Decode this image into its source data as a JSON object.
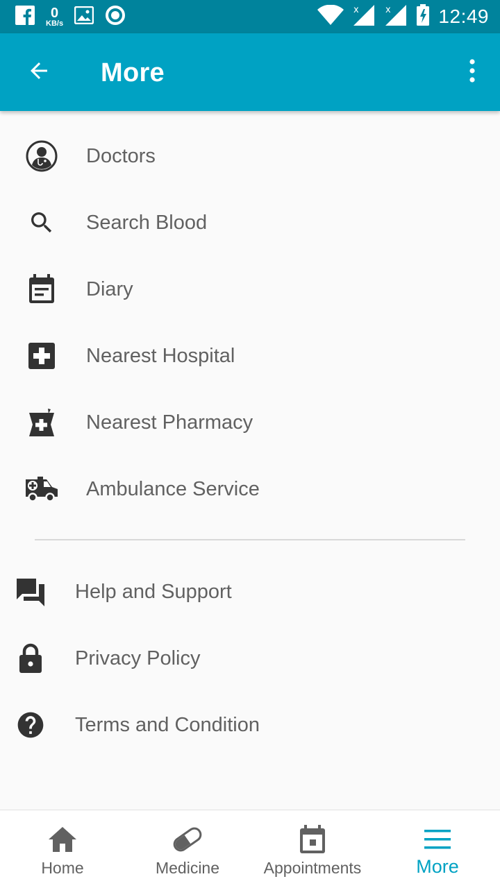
{
  "status_bar": {
    "net_speed_value": "0",
    "net_speed_unit": "KB/s",
    "time": "12:49",
    "icons": [
      "facebook-icon",
      "gallery-icon",
      "record-icon",
      "wifi-icon",
      "signal-icon",
      "signal-icon",
      "battery-charging-icon"
    ]
  },
  "app_bar": {
    "title": "More",
    "color": "#00a2c3"
  },
  "menu": {
    "items": [
      {
        "label": "Doctors",
        "icon": "doctor-icon"
      },
      {
        "label": "Search Blood",
        "icon": "search-icon"
      },
      {
        "label": "Diary",
        "icon": "diary-icon"
      },
      {
        "label": "Nearest Hospital",
        "icon": "hospital-icon"
      },
      {
        "label": "Nearest Pharmacy",
        "icon": "pharmacy-icon"
      },
      {
        "label": "Ambulance Service",
        "icon": "ambulance-icon"
      }
    ],
    "support_items": [
      {
        "label": "Help and Support",
        "icon": "chat-icon"
      },
      {
        "label": "Privacy Policy",
        "icon": "lock-icon"
      },
      {
        "label": "Terms and Condition",
        "icon": "help-icon"
      }
    ]
  },
  "bottom_nav": {
    "tabs": [
      {
        "label": "Home",
        "icon": "home-icon"
      },
      {
        "label": "Medicine",
        "icon": "pill-icon"
      },
      {
        "label": "Appointments",
        "icon": "calendar-icon"
      },
      {
        "label": "More",
        "icon": "menu-icon"
      }
    ],
    "active": "More",
    "active_color": "#00a2c3"
  }
}
